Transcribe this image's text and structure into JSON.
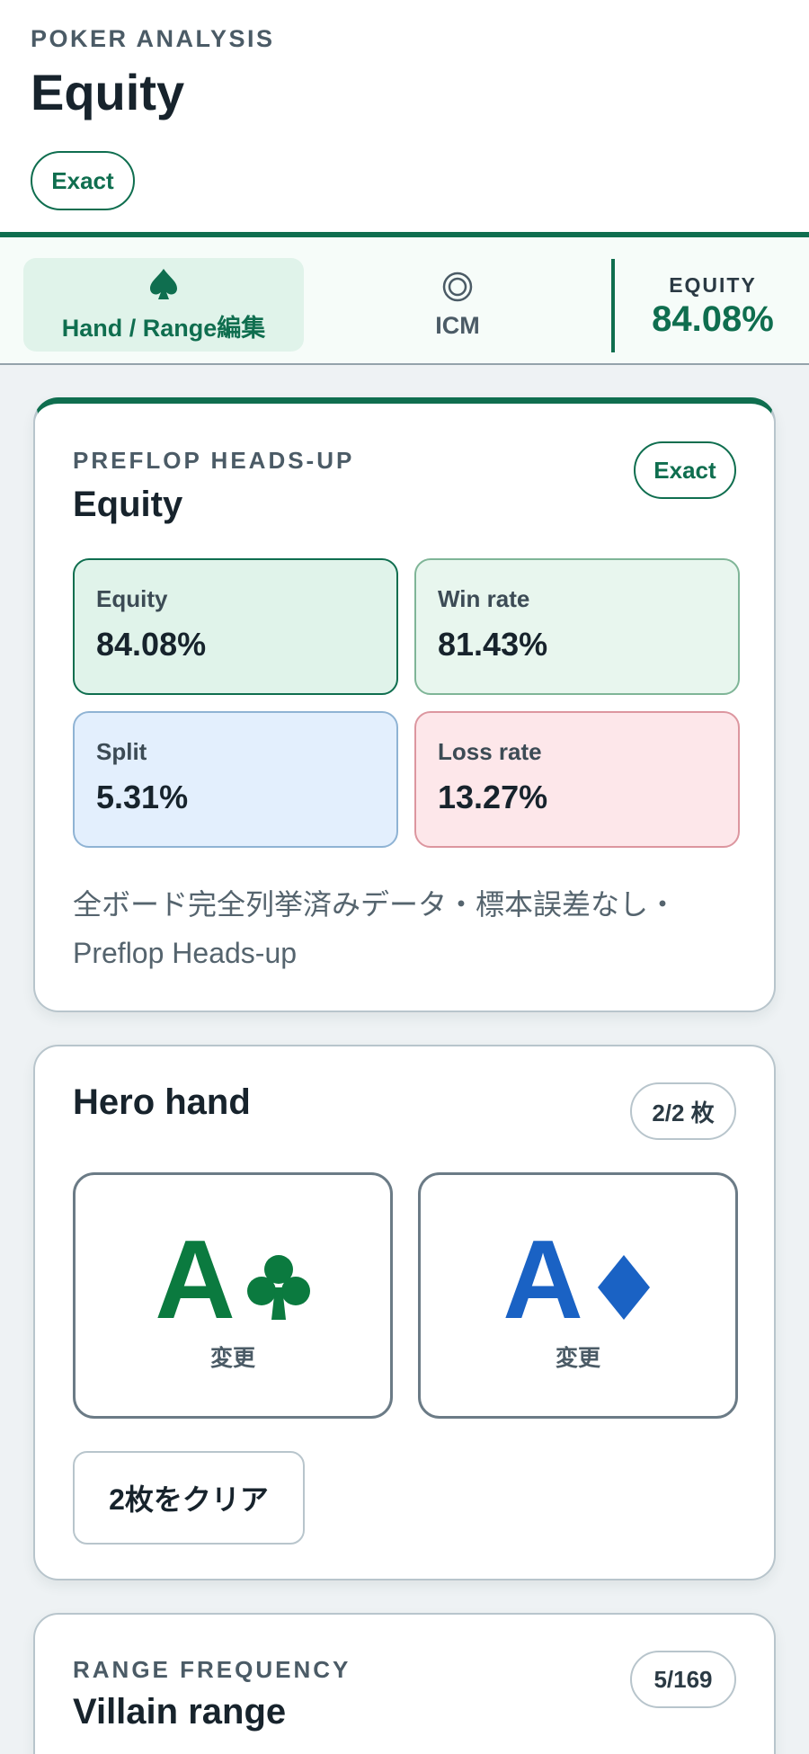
{
  "header": {
    "eyebrow": "POKER ANALYSIS",
    "title": "Equity",
    "badge": "Exact"
  },
  "tabs": {
    "items": [
      {
        "label": "Hand / Range編集",
        "icon": "spade-icon",
        "active": true
      },
      {
        "label": "ICM",
        "icon": "bullseye-icon",
        "active": false
      }
    ],
    "summary_label": "EQUITY",
    "summary_value": "84.08%"
  },
  "equity_card": {
    "eyebrow": "PREFLOP HEADS-UP",
    "title": "Equity",
    "badge": "Exact",
    "stats": [
      {
        "label": "Equity",
        "value": "84.08%"
      },
      {
        "label": "Win rate",
        "value": "81.43%"
      },
      {
        "label": "Split",
        "value": "5.31%"
      },
      {
        "label": "Loss rate",
        "value": "13.27%"
      }
    ],
    "note": "全ボード完全列挙済みデータ・標本誤差なし・Preflop Heads-up"
  },
  "hero_card": {
    "title": "Hero hand",
    "count": "2/2 枚",
    "cards": [
      {
        "rank": "A",
        "suit": "club",
        "color": "#0b7a3f",
        "action": "変更"
      },
      {
        "rank": "A",
        "suit": "diamond",
        "color": "#1a62c4",
        "action": "変更"
      }
    ],
    "clear_label": "2枚をクリア"
  },
  "range_card": {
    "eyebrow": "RANGE FREQUENCY",
    "title": "Villain range",
    "count": "5/169"
  },
  "colors": {
    "accent": "#0f6e4f",
    "equity_bg": "#e0f3ea",
    "win_bg": "#e8f6ee",
    "split_bg": "#e3effd",
    "loss_bg": "#fde7ea"
  }
}
